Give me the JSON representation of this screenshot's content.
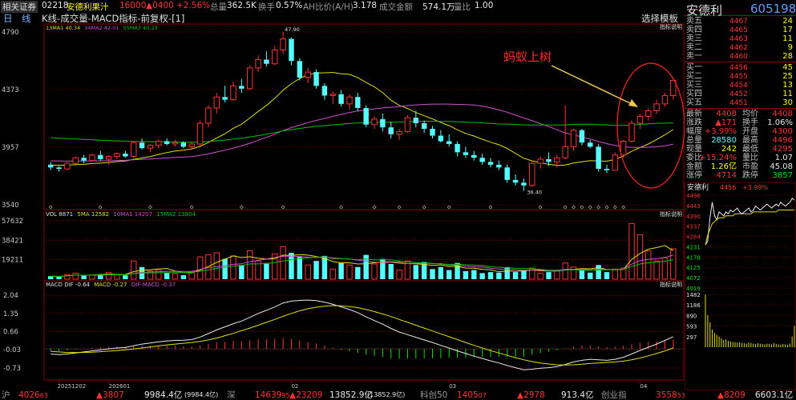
{
  "topbar": {
    "broker": "相关证券",
    "code": "02218",
    "name": "安德利果汁",
    "price": "16000",
    "change": "▲0400",
    "pct": "+2.56%",
    "vol_label": "总量",
    "vol": "362.5K",
    "turnover_label": "换手",
    "turnover": "0.57%",
    "ah_label": "AH比价(A/H)",
    "ah": "3.178",
    "amount_label": "成交金额",
    "amount": "574.1万",
    "ratio_label": "量比",
    "ratio": "1.00"
  },
  "titlebar": {
    "period": "日　线",
    "indicator": "K线-成交量-MACD指标-前复权-[1]",
    "select_template": "选择模板",
    "indicator_desc": "指标说明",
    "desc_2": "指标说明",
    "desc_3": "指标说明"
  },
  "ma_legend": {
    "ma13": "13MA1 40.34",
    "ma34": "34MA2 42.01",
    "ma55": "55MA3 40.23"
  },
  "vol_legend": {
    "vol": "VOL 8871",
    "ma5": "5MA 12582",
    "ma10": "10MA1 14207",
    "ma15": "15MA2 13804"
  },
  "macd_legend": {
    "title": "MACD DIF -0.64",
    "macd": "MACD -0.27",
    "dif": "DIF-MACD -0.37"
  },
  "annotation": "蚂蚁上树",
  "price_axis": [
    "4790",
    "4373",
    "3957",
    "3540"
  ],
  "vol_axis": [
    "57632",
    "38421",
    "19211"
  ],
  "macd_axis": [
    "2.04",
    "1.35",
    "0.66",
    "-0.03",
    "-0.73"
  ],
  "date_axis": [
    "20251202",
    "202601",
    "02",
    "03",
    "04"
  ],
  "price_hi_label": "47.90",
  "price_lo_label": "36.40",
  "colors": {
    "up": "#ff3232",
    "down": "#54ffff",
    "ma1": "#e0e000",
    "ma2": "#d050d0",
    "ma3": "#00c000",
    "grid": "#700000"
  },
  "chart_data": {
    "type": "candlestick",
    "price_axis_range": [
      35.4,
      47.9
    ],
    "candles": [
      [
        38.3,
        38.5,
        37.9,
        38.1
      ],
      [
        38.1,
        38.2,
        37.8,
        38.0
      ],
      [
        38.0,
        38.5,
        37.9,
        38.4
      ],
      [
        38.4,
        38.9,
        38.2,
        38.8
      ],
      [
        38.8,
        39.0,
        38.4,
        38.6
      ],
      [
        38.6,
        39.1,
        38.5,
        39.0
      ],
      [
        39.0,
        39.3,
        38.6,
        38.7
      ],
      [
        38.7,
        39.0,
        38.3,
        38.9
      ],
      [
        38.9,
        39.2,
        38.7,
        39.1
      ],
      [
        39.1,
        39.3,
        38.8,
        38.9
      ],
      [
        38.9,
        40.0,
        38.8,
        39.9
      ],
      [
        39.9,
        40.2,
        39.4,
        39.5
      ],
      [
        39.5,
        39.8,
        39.2,
        39.7
      ],
      [
        39.7,
        40.1,
        39.5,
        40.0
      ],
      [
        40.0,
        40.2,
        39.7,
        39.8
      ],
      [
        39.8,
        40.1,
        39.6,
        39.9
      ],
      [
        39.9,
        40.0,
        39.5,
        39.6
      ],
      [
        39.6,
        39.9,
        39.4,
        39.8
      ],
      [
        39.8,
        41.5,
        39.7,
        41.3
      ],
      [
        41.3,
        42.6,
        41.0,
        42.4
      ],
      [
        42.4,
        43.5,
        42.0,
        43.2
      ],
      [
        43.2,
        44.0,
        42.8,
        43.0
      ],
      [
        43.0,
        44.3,
        42.9,
        44.0
      ],
      [
        44.0,
        44.5,
        43.5,
        43.8
      ],
      [
        43.8,
        45.5,
        43.7,
        45.3
      ],
      [
        45.3,
        46.2,
        45.0,
        45.9
      ],
      [
        45.9,
        46.5,
        45.4,
        45.6
      ],
      [
        45.6,
        46.9,
        45.5,
        46.6
      ],
      [
        46.6,
        47.9,
        46.3,
        47.4
      ],
      [
        47.4,
        47.5,
        45.5,
        45.8
      ],
      [
        45.8,
        46.0,
        44.4,
        44.6
      ],
      [
        44.6,
        45.3,
        44.2,
        45.0
      ],
      [
        45.0,
        45.2,
        43.8,
        44.0
      ],
      [
        44.0,
        44.2,
        43.0,
        43.3
      ],
      [
        43.3,
        43.6,
        42.7,
        43.4
      ],
      [
        43.4,
        43.7,
        42.5,
        42.7
      ],
      [
        42.7,
        43.4,
        42.3,
        43.2
      ],
      [
        43.2,
        43.5,
        42.2,
        42.4
      ],
      [
        42.4,
        42.6,
        41.0,
        41.2
      ],
      [
        41.2,
        41.8,
        40.9,
        41.6
      ],
      [
        41.6,
        42.0,
        40.7,
        41.0
      ],
      [
        41.0,
        41.4,
        40.2,
        40.5
      ],
      [
        40.5,
        40.9,
        40.1,
        40.7
      ],
      [
        40.7,
        41.9,
        40.6,
        41.7
      ],
      [
        41.7,
        42.2,
        41.0,
        41.3
      ],
      [
        41.3,
        41.5,
        40.6,
        40.9
      ],
      [
        40.9,
        41.1,
        40.2,
        40.4
      ],
      [
        40.4,
        40.8,
        39.9,
        40.0
      ],
      [
        40.0,
        40.5,
        39.6,
        39.8
      ],
      [
        39.8,
        40.0,
        38.9,
        39.2
      ],
      [
        39.2,
        39.6,
        38.8,
        39.0
      ],
      [
        39.0,
        39.3,
        38.6,
        38.8
      ],
      [
        38.8,
        39.1,
        38.3,
        38.5
      ],
      [
        38.5,
        38.8,
        38.1,
        38.3
      ],
      [
        38.3,
        38.6,
        37.9,
        38.1
      ],
      [
        38.1,
        38.3,
        37.0,
        37.2
      ],
      [
        37.2,
        37.6,
        36.8,
        37.0
      ],
      [
        37.0,
        37.3,
        36.4,
        36.8
      ],
      [
        36.8,
        38.6,
        36.7,
        38.4
      ],
      [
        38.4,
        38.9,
        38.0,
        38.7
      ],
      [
        38.7,
        39.2,
        38.2,
        38.5
      ],
      [
        38.5,
        39.0,
        38.1,
        38.8
      ],
      [
        38.8,
        42.6,
        38.7,
        39.6
      ],
      [
        39.6,
        40.9,
        39.3,
        40.8
      ],
      [
        40.8,
        40.9,
        39.7,
        39.9
      ],
      [
        39.9,
        40.1,
        39.5,
        39.6
      ],
      [
        39.6,
        39.8,
        37.8,
        38.0
      ],
      [
        38.0,
        38.3,
        37.7,
        37.9
      ],
      [
        37.9,
        39.2,
        37.9,
        39.0
      ],
      [
        39.0,
        40.1,
        38.8,
        40.0
      ],
      [
        40.0,
        41.5,
        39.9,
        41.3
      ],
      [
        41.3,
        42.0,
        40.9,
        41.8
      ],
      [
        41.8,
        42.4,
        41.5,
        42.2
      ],
      [
        42.2,
        43.0,
        42.0,
        42.7
      ],
      [
        42.7,
        43.5,
        42.5,
        43.3
      ],
      [
        43.3,
        44.6,
        43.0,
        44.4
      ]
    ],
    "volume_axis_max": 57632,
    "volumes": [
      3000,
      2500,
      4500,
      6000,
      3500,
      4000,
      5000,
      6500,
      4200,
      3800,
      18000,
      12000,
      8000,
      9000,
      6000,
      5500,
      4000,
      7000,
      22000,
      24000,
      26000,
      20000,
      23000,
      14000,
      28000,
      18000,
      16000,
      25000,
      32000,
      26000,
      22000,
      14000,
      18000,
      23000,
      10000,
      16000,
      14000,
      12000,
      24000,
      15000,
      20000,
      15000,
      9000,
      18000,
      14000,
      17000,
      10000,
      12000,
      9000,
      16000,
      8000,
      9000,
      6000,
      7000,
      6500,
      12000,
      7000,
      9000,
      11000,
      6000,
      7000,
      8000,
      16000,
      12000,
      9000,
      6500,
      14000,
      7000,
      10000,
      11000,
      55000,
      44000,
      28000,
      18000,
      21000,
      30000
    ],
    "macd_axis_range": [
      -1.1,
      2.2
    ],
    "dif": [
      -0.2,
      -0.22,
      -0.2,
      -0.16,
      -0.12,
      -0.08,
      -0.04,
      0.0,
      0.03,
      0.05,
      0.12,
      0.18,
      0.22,
      0.27,
      0.3,
      0.32,
      0.33,
      0.35,
      0.45,
      0.58,
      0.72,
      0.84,
      0.96,
      1.06,
      1.2,
      1.35,
      1.47,
      1.6,
      1.75,
      1.82,
      1.85,
      1.86,
      1.84,
      1.78,
      1.7,
      1.6,
      1.5,
      1.38,
      1.22,
      1.08,
      0.94,
      0.78,
      0.64,
      0.54,
      0.44,
      0.34,
      0.24,
      0.13,
      0.03,
      -0.08,
      -0.18,
      -0.28,
      -0.37,
      -0.46,
      -0.54,
      -0.64,
      -0.72,
      -0.8,
      -0.78,
      -0.74,
      -0.72,
      -0.68,
      -0.6,
      -0.5,
      -0.44,
      -0.4,
      -0.42,
      -0.44,
      -0.4,
      -0.32,
      -0.2,
      -0.06,
      0.06,
      0.18,
      0.32,
      0.46
    ],
    "dea": [
      -0.1,
      -0.12,
      -0.14,
      -0.14,
      -0.14,
      -0.13,
      -0.11,
      -0.09,
      -0.07,
      -0.04,
      -0.01,
      0.03,
      0.07,
      0.11,
      0.15,
      0.18,
      0.21,
      0.24,
      0.28,
      0.34,
      0.41,
      0.5,
      0.59,
      0.69,
      0.79,
      0.9,
      1.01,
      1.12,
      1.24,
      1.35,
      1.45,
      1.53,
      1.59,
      1.63,
      1.65,
      1.64,
      1.61,
      1.57,
      1.5,
      1.42,
      1.33,
      1.23,
      1.12,
      1.01,
      0.9,
      0.79,
      0.68,
      0.57,
      0.46,
      0.35,
      0.24,
      0.13,
      0.03,
      -0.07,
      -0.16,
      -0.25,
      -0.34,
      -0.42,
      -0.49,
      -0.54,
      -0.58,
      -0.61,
      -0.62,
      -0.61,
      -0.59,
      -0.56,
      -0.54,
      -0.52,
      -0.5,
      -0.47,
      -0.42,
      -0.35,
      -0.27,
      -0.18,
      -0.08,
      0.03
    ]
  },
  "right_panel": {
    "name": "安德利",
    "code": "605198",
    "asks": [
      {
        "label": "卖五",
        "price": "4467",
        "vol": "24"
      },
      {
        "label": "卖四",
        "price": "4465",
        "vol": "17"
      },
      {
        "label": "卖三",
        "price": "4463",
        "vol": "11"
      },
      {
        "label": "卖二",
        "price": "4462",
        "vol": "9"
      },
      {
        "label": "卖一",
        "price": "4460",
        "vol": "28"
      }
    ],
    "bids": [
      {
        "label": "买一",
        "price": "4456",
        "vol": "45"
      },
      {
        "label": "买二",
        "price": "4455",
        "vol": "25"
      },
      {
        "label": "买三",
        "price": "4454",
        "vol": "13"
      },
      {
        "label": "买四",
        "price": "4452",
        "vol": "11"
      },
      {
        "label": "买五",
        "price": "4451",
        "vol": "30"
      }
    ],
    "stats": [
      {
        "l1": "最新",
        "v1": "4408",
        "l2": "均价",
        "v2": "4408",
        "c1": "red",
        "c2": "red"
      },
      {
        "l1": "涨跌",
        "v1": "▲171",
        "l2": "换手",
        "v2": "1.06%",
        "c1": "red",
        "c2": "white"
      },
      {
        "l1": "幅度",
        "v1": "+3.99%",
        "l2": "开盘",
        "v2": "4300",
        "c1": "red",
        "c2": "red"
      },
      {
        "l1": "总量",
        "v1": "28580",
        "l2": "最高",
        "v2": "4496",
        "c1": "cyan",
        "c2": "red"
      },
      {
        "l1": "现量",
        "v1": "242",
        "l2": "最低",
        "v2": "4295",
        "c1": "yellow",
        "c2": "red"
      },
      {
        "l1": "委比",
        "v1": "+15.24%",
        "l2": "量比",
        "v2": "1.07",
        "c1": "red",
        "c2": "white"
      },
      {
        "l1": "金额",
        "v1": "1.26亿",
        "l2": "市盈",
        "v2": "45.08",
        "c1": "yellow",
        "c2": "white"
      },
      {
        "l1": "涨停",
        "v1": "4714",
        "l2": "跌停",
        "v2": "3857",
        "c1": "red",
        "c2": "green"
      }
    ],
    "mini_title": "安德利",
    "mini_price": "4456",
    "mini_pct": "+3.99%",
    "mini_axis": [
      "4496",
      "4443",
      "4390",
      "4337",
      "4284",
      "4231",
      "4178",
      "4125",
      "4072",
      "4019"
    ],
    "mini_vol_axis": [
      "1482",
      "1186",
      "890",
      "593",
      "297"
    ],
    "mini_intraday": [
      42.4,
      42.6,
      43.8,
      44.6,
      43.9,
      43.7,
      44.1,
      44.0,
      43.9,
      44.1,
      44.0,
      44.2,
      44.1,
      44.2,
      44.3,
      44.1,
      44.0,
      44.1,
      44.2,
      44.3,
      44.1,
      44.2,
      44.4,
      44.3,
      44.2,
      44.3,
      44.4,
      44.5,
      44.4,
      44.3,
      44.4,
      44.5,
      44.4,
      44.6,
      44.5,
      44.4,
      44.5,
      44.6,
      44.8,
      44.7
    ],
    "mini_avg": [
      42.4,
      42.9,
      43.2,
      43.5,
      43.6,
      43.7,
      43.8,
      43.8,
      43.8,
      43.9,
      43.9,
      43.9,
      43.9,
      44.0,
      44.0,
      44.0,
      44.0,
      44.0,
      44.0,
      44.0,
      44.0,
      44.1,
      44.1,
      44.1,
      44.1,
      44.1,
      44.1,
      44.1,
      44.1,
      44.1,
      44.1,
      44.1,
      44.2,
      44.2,
      44.2,
      44.2,
      44.2,
      44.2,
      44.2,
      44.2
    ],
    "mini_vols": [
      1480,
      900,
      700,
      500,
      400,
      350,
      300,
      250,
      200,
      220,
      180,
      160,
      150,
      140,
      130,
      140,
      120,
      110,
      100,
      130,
      120,
      100,
      90,
      110,
      100,
      90,
      80,
      100,
      90,
      80,
      120,
      90,
      80,
      70,
      90,
      80,
      70,
      100,
      300,
      600
    ]
  },
  "footer": {
    "sh_label": "沪",
    "sh_idx": "4026",
    "sh_idx2": "63",
    "sh_chg": "▲3807",
    "sh_amt": "9984.4亿",
    "sh_amt2": "(9984.4亿)",
    "sz_label": "深",
    "sz_idx": "14639",
    "sz_idx2": "95",
    "sz_chg": "▲23209",
    "sz_amt": "13852.9亿",
    "sz_amt2": "(13852.9亿)",
    "kc_label": "科创50",
    "kc_idx": "1405",
    "kc_idx2": "07",
    "kc_chg": "▲2978",
    "kc_amt": "913.4亿",
    "cy_label": "创业指",
    "cy_idx": "3558",
    "cy_idx2": "53",
    "cy_chg": "▲8209",
    "cy_amt": "6603.1亿"
  }
}
